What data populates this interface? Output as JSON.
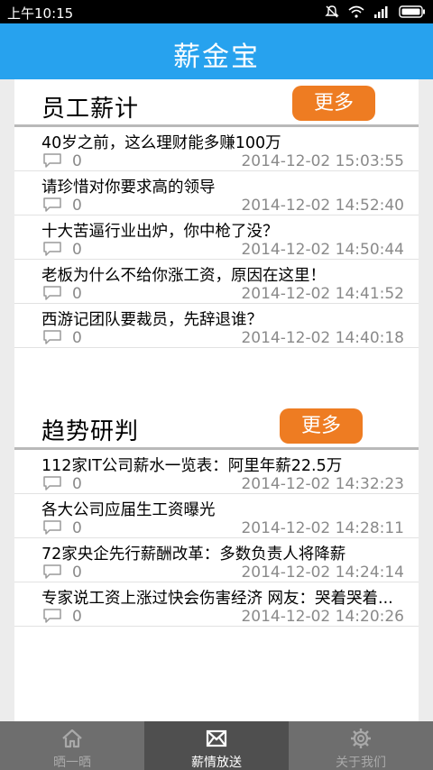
{
  "status_bar": {
    "time": "上午10:15"
  },
  "app": {
    "title": "薪金宝"
  },
  "sections": [
    {
      "title": "员工薪计",
      "more_label": "更多",
      "items": [
        {
          "title": "40岁之前，这么理财能多赚100万",
          "comments": "0",
          "date": "2014-12-02 15:03:55"
        },
        {
          "title": "请珍惜对你要求高的领导",
          "comments": "0",
          "date": "2014-12-02 14:52:40"
        },
        {
          "title": "十大苦逼行业出炉，你中枪了没？",
          "comments": "0",
          "date": "2014-12-02 14:50:44"
        },
        {
          "title": "老板为什么不给你涨工资，原因在这里！",
          "comments": "0",
          "date": "2014-12-02 14:41:52"
        },
        {
          "title": "西游记团队要裁员，先辞退谁？",
          "comments": "0",
          "date": "2014-12-02 14:40:18"
        }
      ]
    },
    {
      "title": "趋势研判",
      "more_label": "更多",
      "items": [
        {
          "title": "112家IT公司薪水一览表：阿里年薪22.5万",
          "comments": "0",
          "date": "2014-12-02 14:32:23"
        },
        {
          "title": "各大公司应届生工资曝光",
          "comments": "0",
          "date": "2014-12-02 14:28:11"
        },
        {
          "title": "72家央企先行薪酬改革：多数负责人将降薪",
          "comments": "0",
          "date": "2014-12-02 14:24:14"
        },
        {
          "title": "专家说工资上涨过快会伤害经济 网友：哭着哭着...",
          "comments": "0",
          "date": "2014-12-02 14:20:26"
        }
      ]
    }
  ],
  "tabs": [
    {
      "label": "晒一晒",
      "icon": "home-icon",
      "active": false
    },
    {
      "label": "薪情放送",
      "icon": "mail-icon",
      "active": true
    },
    {
      "label": "关于我们",
      "icon": "gear-icon",
      "active": false
    }
  ],
  "colors": {
    "title_bar": "#27a2ee",
    "more_button": "#ee7c22",
    "tab_bar": "#6e6e6e",
    "tab_active": "#4f4f4f"
  }
}
